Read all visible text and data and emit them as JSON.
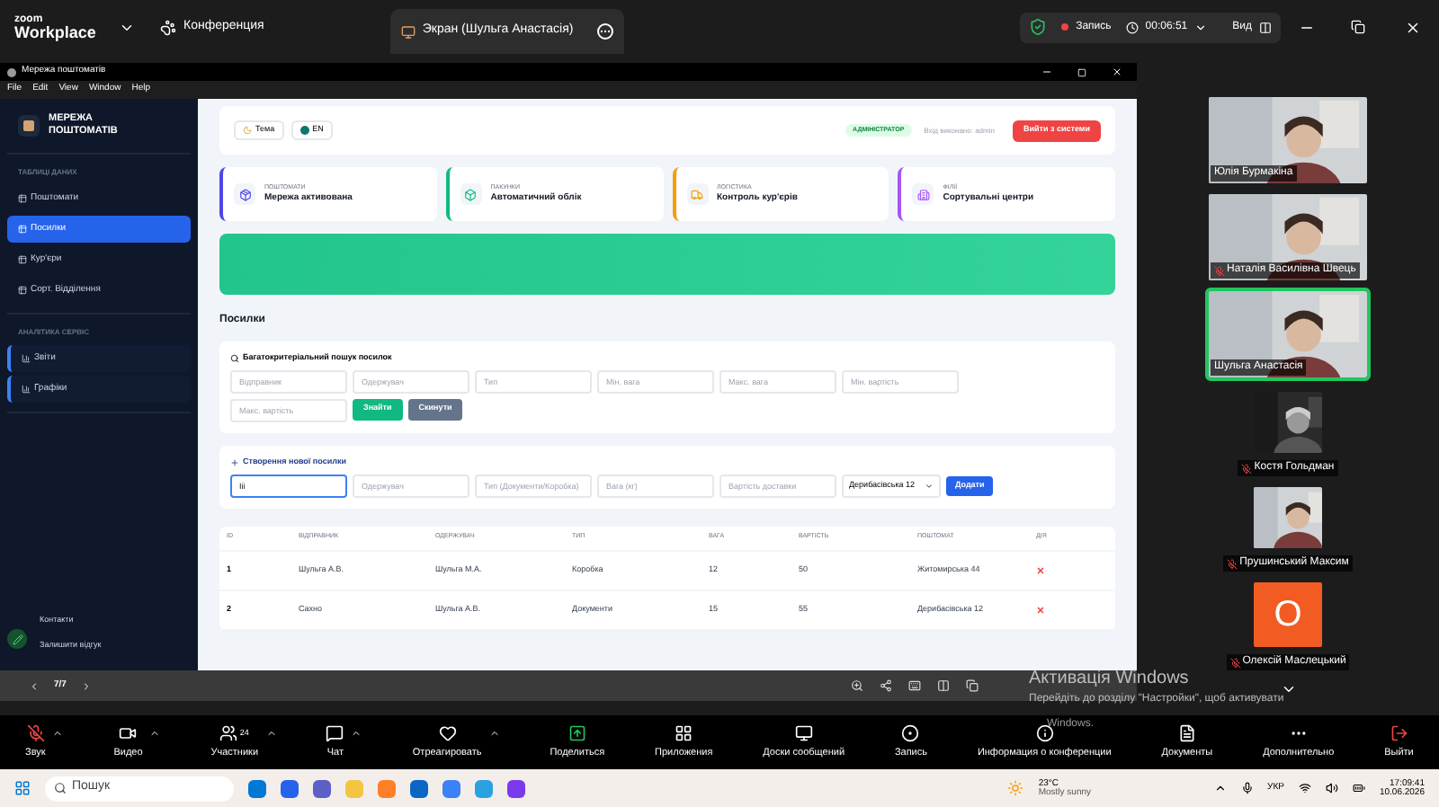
{
  "zoom_bar": {
    "logo_top": "zoom",
    "logo_bottom": "Workplace",
    "meeting_tab": "Конференция",
    "share_tab": "Экран (Шульга Анастасія)",
    "recording": "Запись",
    "timer": "00:06:51",
    "view": "Вид"
  },
  "shared_window": {
    "title": "Мережа поштоматів",
    "menu": [
      "File",
      "Edit",
      "View",
      "Window",
      "Help"
    ]
  },
  "sidebar": {
    "brand": "МЕРЕЖА ПОШТОМАТІВ",
    "sections": [
      {
        "title": "ТАБЛИЦІ ДАНИХ",
        "items": [
          {
            "label": "Поштомати",
            "selected": false,
            "kind": "plain"
          },
          {
            "label": "Посилки",
            "selected": true,
            "kind": "plain"
          },
          {
            "label": "Кур'єри",
            "selected": false,
            "kind": "plain"
          },
          {
            "label": "Сорт. Відділення",
            "selected": false,
            "kind": "plain"
          }
        ]
      },
      {
        "title": "АНАЛІТИКА СЕРВІС",
        "items": [
          {
            "label": "Звіти",
            "selected": false,
            "kind": "bordered"
          },
          {
            "label": "Графіки",
            "selected": false,
            "kind": "bordered"
          }
        ]
      }
    ],
    "footer": [
      "Контакти",
      "Залишити відгук"
    ]
  },
  "header": {
    "theme": "Тема",
    "language": "EN",
    "role": "АДМІНІСТРАТОР",
    "user": "Вхід виконано: admin",
    "logout": "Вийти з системи"
  },
  "cards": [
    {
      "caption": "ПОШТОМАТИ",
      "title": "Мережа активована",
      "color": "#4f46e5"
    },
    {
      "caption": "ПАКУНКИ",
      "title": "Автоматичний облік",
      "color": "#10b981"
    },
    {
      "caption": "ЛОГІСТИКА",
      "title": "Контроль кур'єрів",
      "color": "#f59e0b"
    },
    {
      "caption": "ФІЛІЇ",
      "title": "Сортувальні центри",
      "color": "#a855f7"
    }
  ],
  "section_title": "Посилки",
  "search": {
    "title": "Багатокритеріальний пошук посилок",
    "fields": [
      {
        "placeholder": "Відправник"
      },
      {
        "placeholder": "Одержувач"
      },
      {
        "placeholder": "Тип"
      },
      {
        "placeholder": "Мін. вага"
      },
      {
        "placeholder": "Макс. вага"
      },
      {
        "placeholder": "Мін. вартість"
      },
      {
        "placeholder": "Макс. вартість"
      }
    ],
    "find": "Знайти",
    "reset": "Скинути"
  },
  "create": {
    "title": "Створення нової посилки",
    "fields": [
      {
        "value": "Ііі"
      },
      {
        "placeholder": "Одержувач"
      },
      {
        "placeholder": "Тип (Документи/Коробка)"
      },
      {
        "placeholder": "Вага (кг)"
      },
      {
        "placeholder": "Вартість доставки"
      }
    ],
    "select": "Дерибасівська 12",
    "add": "Додати"
  },
  "table": {
    "columns": [
      "ID",
      "ВІДПРАВНИК",
      "ОДЕРЖУВАЧ",
      "ТИП",
      "ВАГА",
      "ВАРТІСТЬ",
      "ПОШТОМАТ",
      "ДІЯ"
    ],
    "rows": [
      [
        "1",
        "Шульга А.В.",
        "Шульга М.А.",
        "Коробка",
        "12",
        "50",
        "Житомирська 44"
      ],
      [
        "2",
        "Сахно",
        "Шульга А.В.",
        "Документи",
        "15",
        "55",
        "Дерибасівська 12"
      ]
    ]
  },
  "share_controls": {
    "page": "7/7"
  },
  "participants": [
    {
      "name": "Юлія Бурмакіна",
      "kind": "video",
      "muted": false,
      "active": false
    },
    {
      "name": "Наталія Василівна Швець",
      "kind": "video",
      "muted": true,
      "active": false
    },
    {
      "name": "Шульга Анастасія",
      "kind": "video",
      "muted": false,
      "active": true
    },
    {
      "name": "Костя Гольдман",
      "kind": "small_video",
      "muted": true,
      "active": false
    },
    {
      "name": "Прушинський Максим",
      "kind": "small_video",
      "muted": true,
      "active": false
    },
    {
      "name": "Олексій Маслецький",
      "kind": "avatar",
      "letter": "О",
      "muted": true,
      "active": false
    }
  ],
  "activation": {
    "title": "Активація Windows",
    "hint": "Перейдіть до розділу \"Настройки\", щоб активувати",
    "hint_end": "Windows."
  },
  "toolbar": [
    {
      "label": "Звук",
      "caret": true
    },
    {
      "label": "Видео",
      "caret": true
    },
    {
      "label": "Участники",
      "count": "24",
      "caret": true
    },
    {
      "label": "Чат",
      "caret": true
    },
    {
      "label": "Отреагировать",
      "caret": true
    },
    {
      "label": "Поделиться",
      "caret": false
    },
    {
      "label": "Приложения",
      "caret": false
    },
    {
      "label": "Доски сообщений",
      "caret": false
    },
    {
      "label": "Запись",
      "caret": false
    },
    {
      "label": "Информация о конференции",
      "caret": false
    },
    {
      "label": "Документы",
      "caret": false
    },
    {
      "label": "Дополнительно",
      "caret": false
    },
    {
      "label": "Выйти",
      "caret": false
    }
  ],
  "taskbar": {
    "search": "Пошук",
    "temperature": "23°C",
    "weather": "Mostly sunny",
    "language": "УКР",
    "time": "17:09:41",
    "date": "10.06.2026"
  }
}
